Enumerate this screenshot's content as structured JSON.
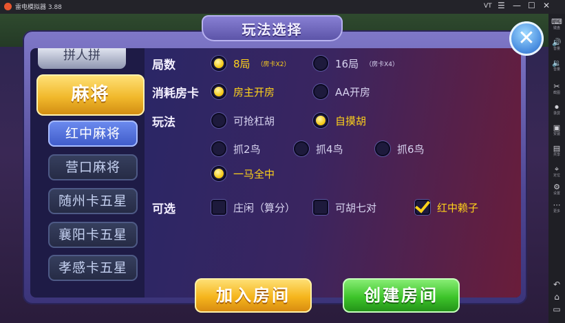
{
  "emulator": {
    "title": "雷电模拟器 3.88",
    "window_controls": [
      "VT",
      "☰",
      "—",
      "☐",
      "✕"
    ],
    "sidebar": [
      {
        "icon": "keyboard-icon",
        "glyph": "⌨",
        "label": "键盘"
      },
      {
        "icon": "volume-up-icon",
        "glyph": "🔊",
        "label": "音量"
      },
      {
        "icon": "volume-down-icon",
        "glyph": "🔉",
        "label": "音量"
      },
      {
        "icon": "scissors-icon",
        "glyph": "✂",
        "label": "截图"
      },
      {
        "icon": "record-icon",
        "glyph": "⏺",
        "label": "录屏"
      },
      {
        "icon": "apk-icon",
        "glyph": "▣",
        "label": "安装"
      },
      {
        "icon": "folder-icon",
        "glyph": "▤",
        "label": "共享"
      },
      {
        "icon": "location-icon",
        "glyph": "⌖",
        "label": "定位"
      },
      {
        "icon": "settings-icon",
        "glyph": "⚙",
        "label": "设置"
      },
      {
        "icon": "more-icon",
        "glyph": "⋯",
        "label": "更多"
      }
    ],
    "nav": [
      {
        "icon": "back-icon",
        "glyph": "↶"
      },
      {
        "icon": "home-icon",
        "glyph": "⌂"
      },
      {
        "icon": "recents-icon",
        "glyph": "▭"
      }
    ]
  },
  "dialog": {
    "title": "玩法选择",
    "close_glyph": "✕",
    "category_top": "拼人拼",
    "category_selected": "麻将",
    "games": [
      {
        "label": "红中麻将",
        "selected": true
      },
      {
        "label": "营口麻将",
        "selected": false
      },
      {
        "label": "随州卡五星",
        "selected": false
      },
      {
        "label": "襄阳卡五星",
        "selected": false
      },
      {
        "label": "孝感卡五星",
        "selected": false
      }
    ],
    "rows": {
      "rounds": {
        "label": "局数",
        "options": [
          {
            "label": "8局",
            "sub": "（房卡X2）",
            "on": true
          },
          {
            "label": "16局",
            "sub": "（房卡X4）",
            "on": false
          }
        ]
      },
      "cost": {
        "label": "消耗房卡",
        "options": [
          {
            "label": "房主开房",
            "on": true
          },
          {
            "label": "AA开房",
            "on": false
          }
        ]
      },
      "play": {
        "label": "玩法",
        "options": [
          {
            "label": "可抢杠胡",
            "on": false
          },
          {
            "label": "自摸胡",
            "on": true
          },
          {
            "label": "抓2鸟",
            "on": false
          },
          {
            "label": "抓4鸟",
            "on": false
          },
          {
            "label": "抓6鸟",
            "on": false
          },
          {
            "label": "一马全中",
            "on": true
          }
        ]
      },
      "optional": {
        "label": "可选",
        "options": [
          {
            "label": "庄闲（算分）",
            "on": false
          },
          {
            "label": "可胡七对",
            "on": false
          },
          {
            "label": "红中赖子",
            "on": true
          }
        ]
      }
    },
    "join_label": "加入房间",
    "create_label": "创建房间"
  }
}
